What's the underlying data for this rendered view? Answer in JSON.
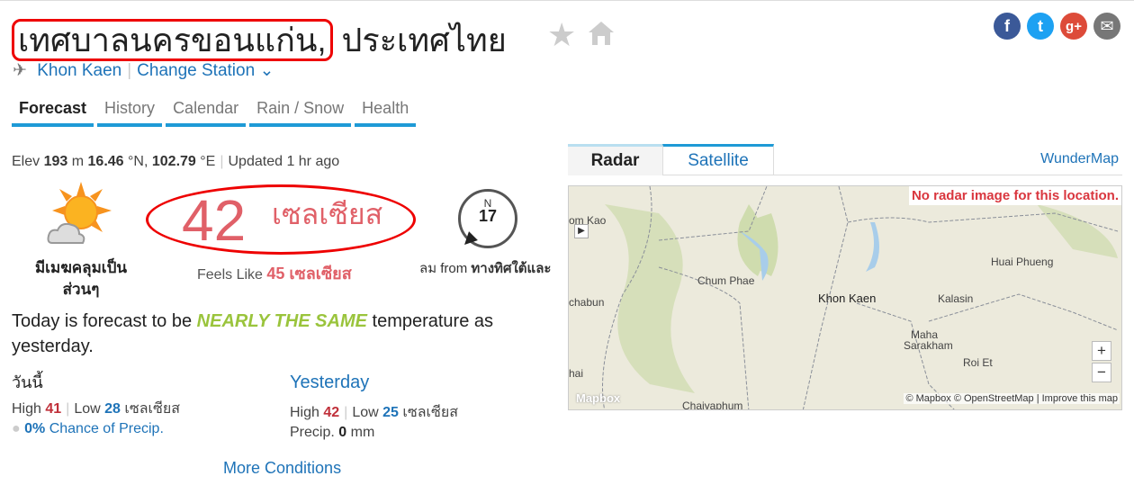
{
  "header": {
    "title_highlight": "เทศบาลนครขอนแก่น,",
    "title_rest": " ประเทศไทย",
    "favorite_icon": "star-icon",
    "home_icon": "home-icon"
  },
  "social": [
    {
      "name": "facebook",
      "glyph": "f",
      "color": "#3b5998"
    },
    {
      "name": "twitter",
      "glyph": "t",
      "color": "#1da1f2"
    },
    {
      "name": "google-plus",
      "glyph": "g+",
      "color": "#dd4b39"
    },
    {
      "name": "email",
      "glyph": "✉",
      "color": "#777777"
    }
  ],
  "station": {
    "name": "Khon Kaen",
    "change": "Change Station"
  },
  "tabs": [
    {
      "label": "Forecast"
    },
    {
      "label": "History"
    },
    {
      "label": "Calendar"
    },
    {
      "label": "Rain / Snow"
    },
    {
      "label": "Health"
    }
  ],
  "info": {
    "elev_label": "Elev",
    "elev": "193",
    "elev_unit": "m",
    "lat": "16.46",
    "lat_unit": "°N,",
    "lon": "102.79",
    "lon_unit": "°E",
    "updated": "Updated 1 hr ago"
  },
  "current": {
    "condition": "มีเมฆคลุมเป็นส่วนๆ",
    "temp": "42",
    "unit": "เซลเซียส",
    "feels_label": "Feels Like",
    "feels": "45 เซลเซียส",
    "wind_dir": "N",
    "wind_speed": "17",
    "wind_label": "ลม from",
    "wind_from": "ทางทิศใต้และ"
  },
  "forecast": {
    "pre": "Today is forecast to be ",
    "emph": "NEARLY THE SAME",
    "post": " temperature as yesterday."
  },
  "today": {
    "heading": "วันนี้",
    "high_label": "High",
    "high": "41",
    "low_label": "Low",
    "low": "28",
    "unit": "เซลเซียส",
    "precip_pct": "0%",
    "precip_label": "Chance of Precip."
  },
  "yesterday": {
    "heading": "Yesterday",
    "high_label": "High",
    "high": "42",
    "low_label": "Low",
    "low": "25",
    "unit": "เซลเซียส",
    "precip_label": "Precip.",
    "precip": "0",
    "precip_unit": "mm"
  },
  "more": "More Conditions",
  "map": {
    "tabs": [
      "Radar",
      "Satellite"
    ],
    "wundermap": "WunderMap",
    "notice": "No radar image for this location.",
    "labels": [
      "om Kao",
      "Chum Phae",
      "Khon Kaen",
      "Huai Phueng",
      "Kalasin",
      "chabun",
      "Maha",
      "Sarakham",
      "Roi Et",
      "hai",
      "Chaiyaphum"
    ],
    "attribution": "© Mapbox © OpenStreetMap | Improve this map",
    "logo": "Mapbox",
    "zoom_in": "+",
    "zoom_out": "−"
  }
}
